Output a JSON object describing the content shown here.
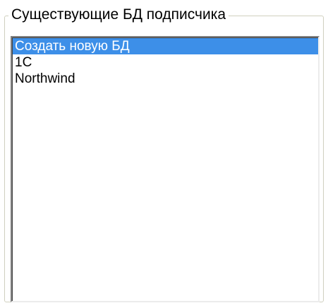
{
  "groupbox": {
    "title": "Существующие БД подписчика"
  },
  "listbox": {
    "selected_index": 0,
    "items": [
      {
        "label": "Создать новую БД"
      },
      {
        "label": "1C"
      },
      {
        "label": "Northwind"
      }
    ]
  },
  "colors": {
    "selection_background": "#3d8fe8",
    "selection_text": "#ffffff",
    "groupbox_border": "#d0d0bf"
  }
}
